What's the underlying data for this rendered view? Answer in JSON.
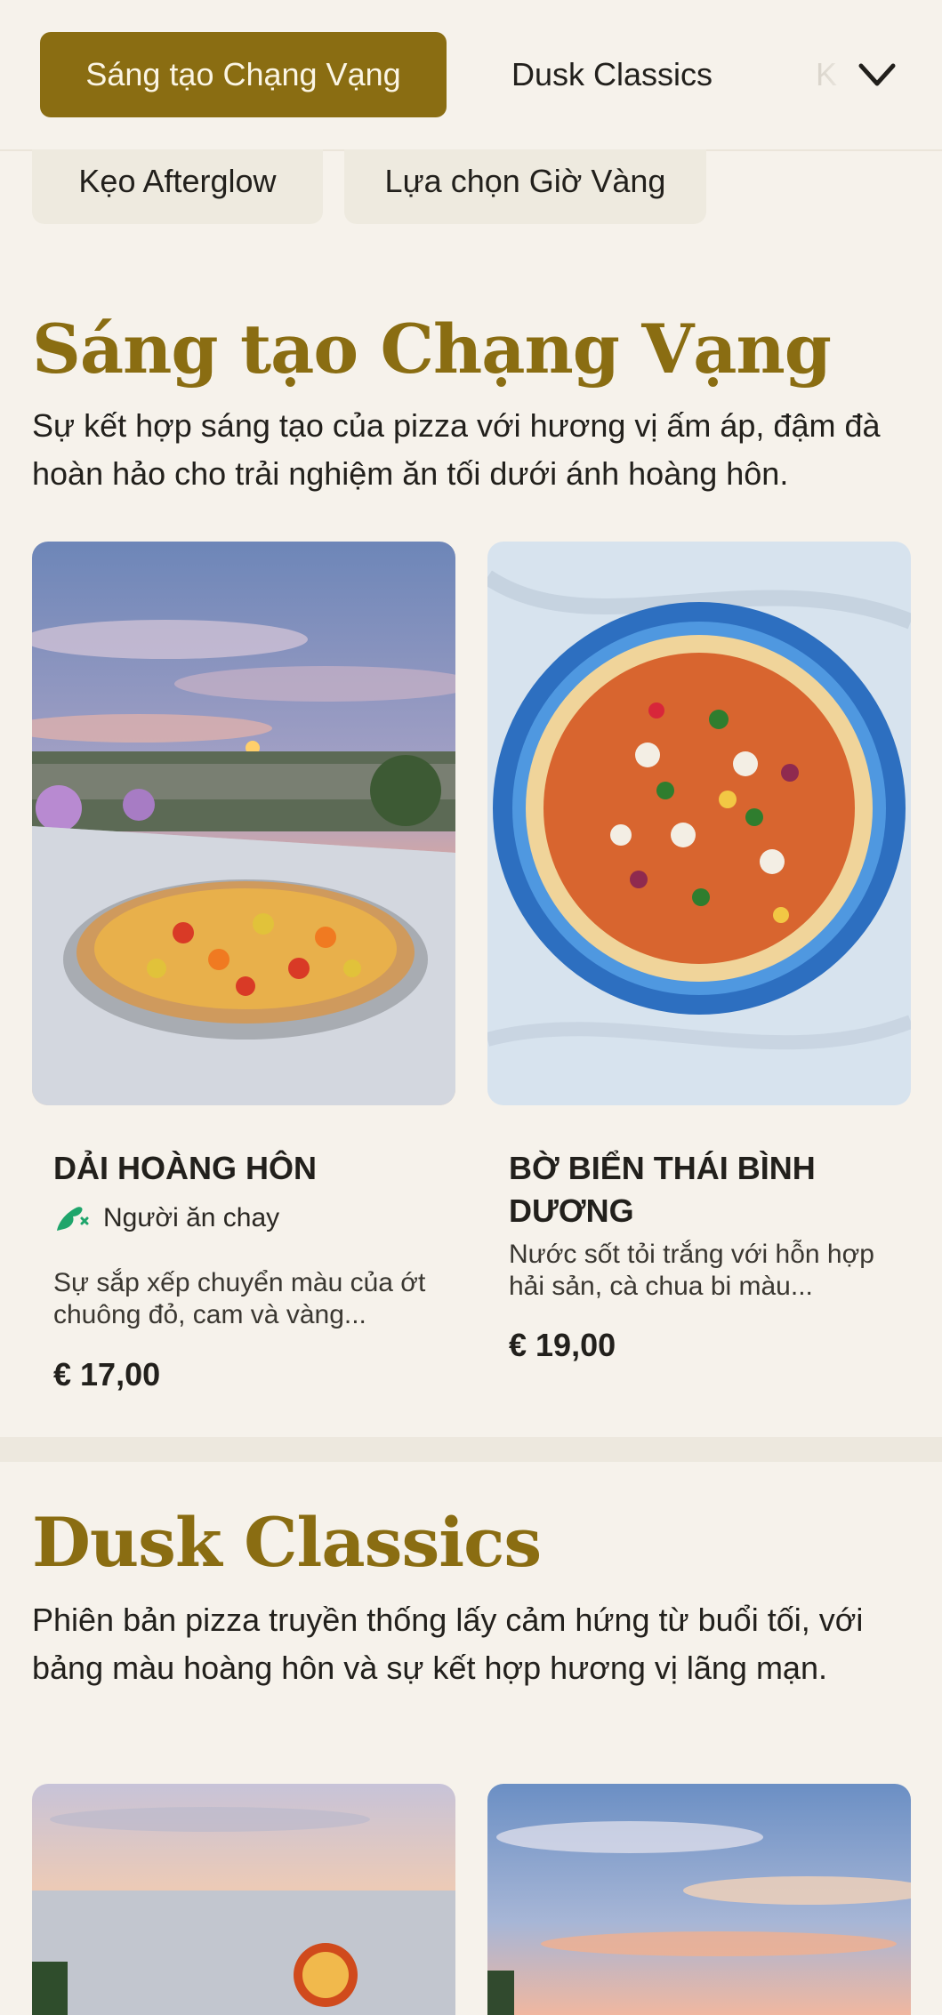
{
  "nav": {
    "tabs": [
      {
        "label": "Sáng tạo Chạng Vạng",
        "active": true
      },
      {
        "label": "Dusk Classics"
      },
      {
        "label": "K"
      }
    ],
    "subtabs": [
      "Kẹo Afterglow",
      "Lựa chọn Giờ Vàng"
    ],
    "expand_icon": "chevron-down-icon"
  },
  "sections": [
    {
      "title": "Sáng tạo Chạng Vạng",
      "description": "Sự kết hợp sáng tạo của pizza với hương vị ấm áp, đậm đà hoàn hảo cho trải nghiệm ăn tối dưới ánh hoàng hôn.",
      "items": [
        {
          "name": "DẢI HOÀNG HÔN",
          "badge": "Người ăn chay",
          "badge_icon": "vegetarian-icon",
          "description": "Sự sắp xếp chuyển màu của ớt chuông đỏ, cam và vàng...",
          "price": "€ 17,00"
        },
        {
          "name": "BỜ BIỂN THÁI BÌNH DƯƠNG",
          "description": "Nước sốt tỏi trắng với hỗn hợp hải sản, cà chua bi màu...",
          "price": "€ 19,00"
        }
      ]
    },
    {
      "title": "Dusk Classics",
      "description": "Phiên bản pizza truyền thống lấy cảm hứng từ buổi tối, với bảng màu hoàng hôn và sự kết hợp hương vị lãng mạn."
    }
  ],
  "colors": {
    "accent": "#8a6d12",
    "background": "#f6f2eb",
    "veg_badge": "#1fa56b"
  }
}
